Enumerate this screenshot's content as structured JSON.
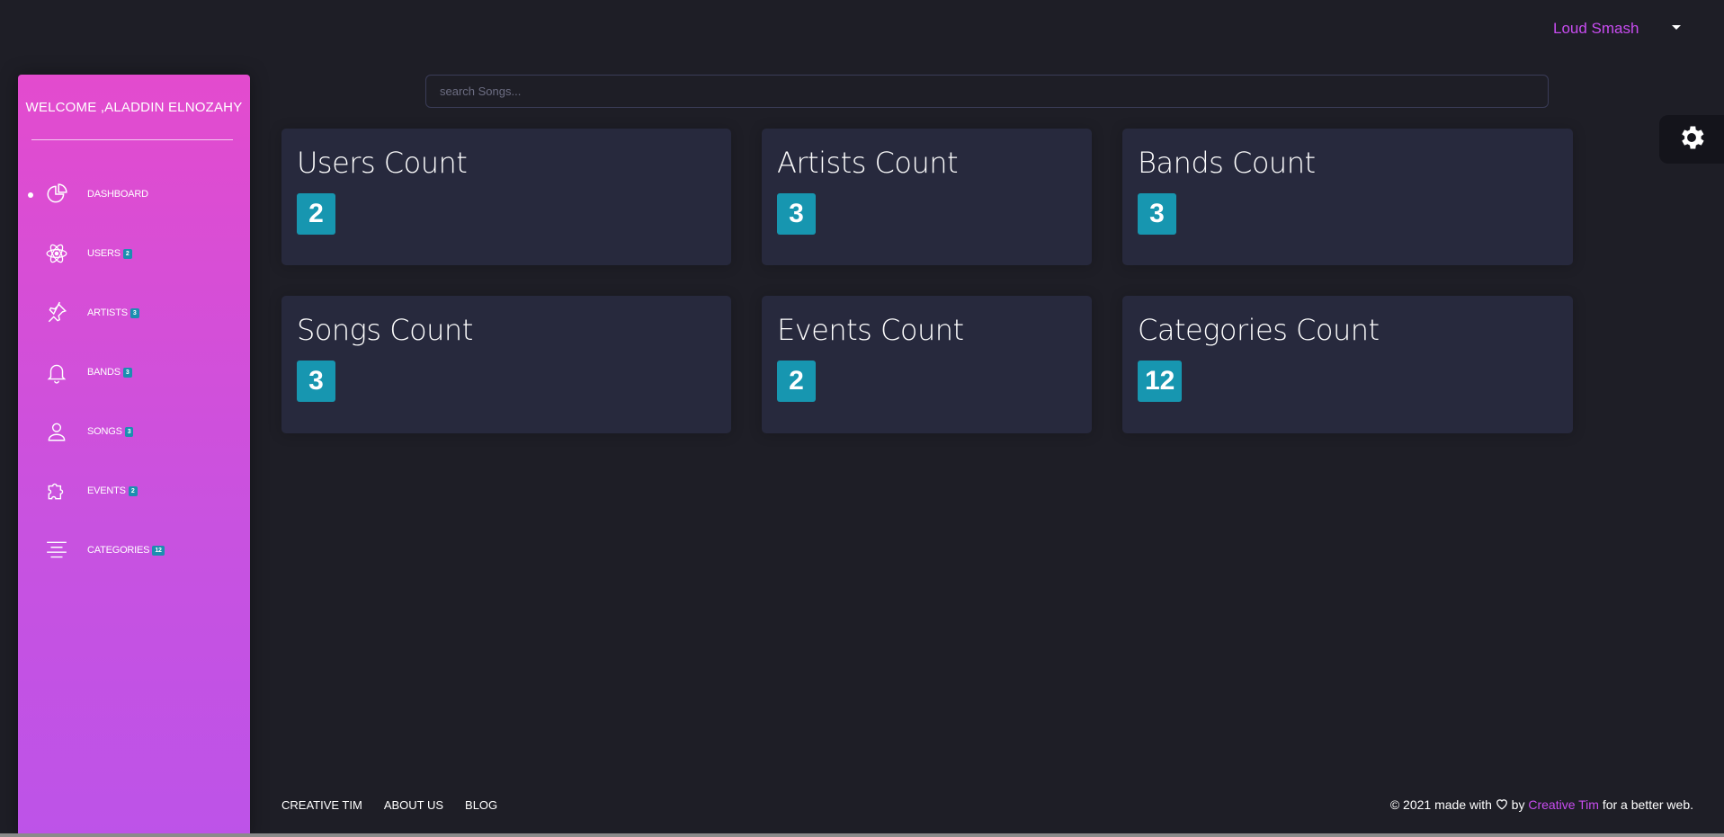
{
  "topbar": {
    "user_name": "Loud Smash"
  },
  "sidebar": {
    "welcome": "WELCOME ,ALADDIN ELNOZAHY",
    "items": [
      {
        "label": "DASHBOARD",
        "icon": "chart-pie-icon",
        "badge": "",
        "active": true
      },
      {
        "label": "USERS",
        "icon": "atom-icon",
        "badge": "2"
      },
      {
        "label": "ARTISTS",
        "icon": "pin-icon",
        "badge": "3"
      },
      {
        "label": "BANDS",
        "icon": "bell-icon",
        "badge": "3"
      },
      {
        "label": "SONGS",
        "icon": "user-icon",
        "badge": "3"
      },
      {
        "label": "EVENTS",
        "icon": "puzzle-icon",
        "badge": "2"
      },
      {
        "label": "CATEGORIES",
        "icon": "align-center-icon",
        "badge": "12"
      }
    ]
  },
  "search": {
    "placeholder": "search Songs..."
  },
  "cards": [
    {
      "title": "Users Count",
      "value": "2"
    },
    {
      "title": "Artists Count",
      "value": "3"
    },
    {
      "title": "Bands Count",
      "value": "3"
    },
    {
      "title": "Songs Count",
      "value": "3"
    },
    {
      "title": "Events Count",
      "value": "2"
    },
    {
      "title": "Categories Count",
      "value": "12"
    }
  ],
  "footer": {
    "links": [
      "CREATIVE TIM",
      "ABOUT US",
      "BLOG"
    ],
    "copyright_prefix": "© 2021 made with",
    "by": "by",
    "brand": "Creative Tim",
    "suffix": "for a better web."
  },
  "colors": {
    "accent": "#c84cf0",
    "badge": "#1796b0",
    "card": "#27293d",
    "background": "#1e1e26"
  }
}
